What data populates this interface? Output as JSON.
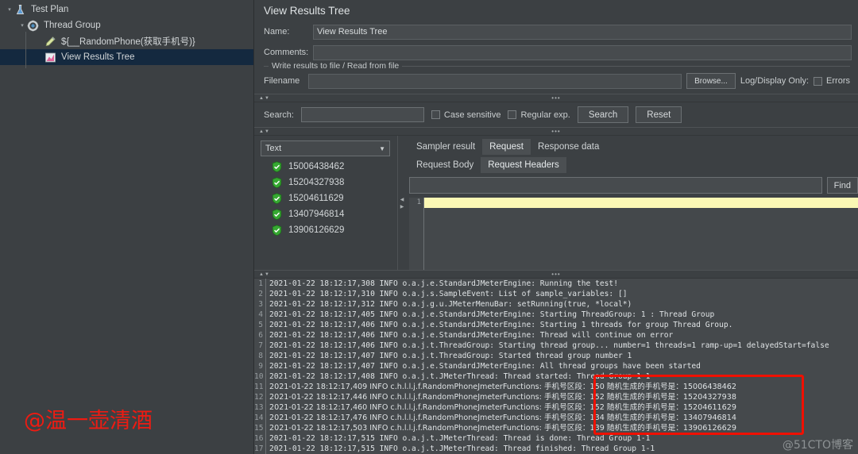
{
  "tree": {
    "nodes": [
      {
        "label": "Test Plan",
        "icon": "test-plan-icon",
        "indent": 1,
        "toggle": "▾",
        "selected": false
      },
      {
        "label": "Thread Group",
        "icon": "thread-group-gear-icon",
        "indent": 2,
        "toggle": "▾",
        "selected": false
      },
      {
        "label": "${__RandomPhone(获取手机号)}",
        "icon": "pen-icon",
        "indent": 3,
        "toggle": "",
        "selected": false
      },
      {
        "label": "View Results Tree",
        "icon": "results-chart-icon",
        "indent": 3,
        "toggle": "",
        "selected": true
      }
    ]
  },
  "panel": {
    "title": "View Results Tree",
    "name_label": "Name:",
    "name_value": "View Results Tree",
    "comments_label": "Comments:",
    "comments_value": "",
    "file_group_label": "Write results to file / Read from file",
    "filename_label": "Filename",
    "filename_value": "",
    "browse_label": "Browse...",
    "logdisplay_label": "Log/Display Only:",
    "errors_label": "Errors",
    "errors_checked": false
  },
  "search": {
    "label": "Search:",
    "value": "",
    "case_sensitive_label": "Case sensitive",
    "case_sensitive_checked": false,
    "regular_exp_label": "Regular exp.",
    "regular_exp_checked": false,
    "search_button": "Search",
    "reset_button": "Reset"
  },
  "results": {
    "renderer_selected": "Text",
    "items": [
      {
        "label": "15006438462",
        "status": "success"
      },
      {
        "label": "15204327938",
        "status": "success"
      },
      {
        "label": "15204611629",
        "status": "success"
      },
      {
        "label": "13407946814",
        "status": "success"
      },
      {
        "label": "13906126629",
        "status": "success"
      }
    ]
  },
  "detail": {
    "tabs": [
      {
        "label": "Sampler result",
        "active": false
      },
      {
        "label": "Request",
        "active": true
      },
      {
        "label": "Response data",
        "active": false
      }
    ],
    "subtabs": [
      {
        "label": "Request Body",
        "active": false
      },
      {
        "label": "Request Headers",
        "active": true
      }
    ],
    "find_value": "",
    "find_button": "Find",
    "editor_line_number": "1"
  },
  "console": {
    "lines": [
      {
        "n": "1",
        "text": "2021-01-22 18:12:17,308 INFO o.a.j.e.StandardJMeterEngine: Running the test!"
      },
      {
        "n": "2",
        "text": "2021-01-22 18:12:17,310 INFO o.a.j.s.SampleEvent: List of sample_variables: []"
      },
      {
        "n": "3",
        "text": "2021-01-22 18:12:17,312 INFO o.a.j.g.u.JMeterMenuBar: setRunning(true, *local*)"
      },
      {
        "n": "4",
        "text": "2021-01-22 18:12:17,405 INFO o.a.j.e.StandardJMeterEngine: Starting ThreadGroup: 1 : Thread Group"
      },
      {
        "n": "5",
        "text": "2021-01-22 18:12:17,406 INFO o.a.j.e.StandardJMeterEngine: Starting 1 threads for group Thread Group."
      },
      {
        "n": "6",
        "text": "2021-01-22 18:12:17,406 INFO o.a.j.e.StandardJMeterEngine: Thread will continue on error"
      },
      {
        "n": "7",
        "text": "2021-01-22 18:12:17,406 INFO o.a.j.t.ThreadGroup: Starting thread group... number=1 threads=1 ramp-up=1 delayedStart=false"
      },
      {
        "n": "8",
        "text": "2021-01-22 18:12:17,407 INFO o.a.j.t.ThreadGroup: Started thread group number 1"
      },
      {
        "n": "9",
        "text": "2021-01-22 18:12:17,407 INFO o.a.j.e.StandardJMeterEngine: All thread groups have been started"
      },
      {
        "n": "10",
        "text": "2021-01-22 18:12:17,408 INFO o.a.j.t.JMeterThread: Thread started: Thread Group 1-1"
      },
      {
        "n": "11",
        "text": "2021-01-22 18:12:17,409 INFO c.h.l.l.j.f.RandomPhoneJmeterFunctions: 手机号区段：150 随机生成的手机号是：15006438462"
      },
      {
        "n": "12",
        "text": "2021-01-22 18:12:17,446 INFO c.h.l.l.j.f.RandomPhoneJmeterFunctions: 手机号区段：152 随机生成的手机号是：15204327938"
      },
      {
        "n": "13",
        "text": "2021-01-22 18:12:17,460 INFO c.h.l.l.j.f.RandomPhoneJmeterFunctions: 手机号区段：152 随机生成的手机号是：15204611629"
      },
      {
        "n": "14",
        "text": "2021-01-22 18:12:17,476 INFO c.h.l.l.j.f.RandomPhoneJmeterFunctions: 手机号区段：134 随机生成的手机号是：13407946814"
      },
      {
        "n": "15",
        "text": "2021-01-22 18:12:17,503 INFO c.h.l.l.j.f.RandomPhoneJmeterFunctions: 手机号区段：139 随机生成的手机号是：13906126629"
      },
      {
        "n": "16",
        "text": "2021-01-22 18:12:17,515 INFO o.a.j.t.JMeterThread: Thread is done: Thread Group 1-1"
      },
      {
        "n": "17",
        "text": "2021-01-22 18:12:17,515 INFO o.a.j.t.JMeterThread: Thread finished: Thread Group 1-1"
      }
    ]
  },
  "watermarks": {
    "author": "@温一壶清酒",
    "site": "@51CTO博客"
  },
  "colors": {
    "background": "#3c4043",
    "selection": "#14293f",
    "annotation_red": "#f01000",
    "highlight_yellow": "#fbf8b4",
    "success_green": "#36a832"
  }
}
